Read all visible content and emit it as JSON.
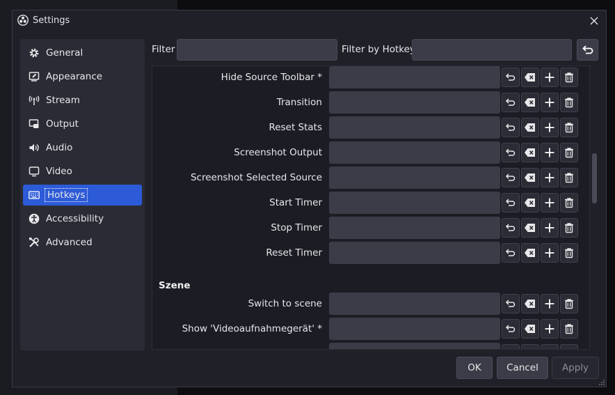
{
  "window": {
    "title": "Settings"
  },
  "sidebar": {
    "items": [
      {
        "label": "General",
        "icon": "gear-icon"
      },
      {
        "label": "Appearance",
        "icon": "appearance-icon"
      },
      {
        "label": "Stream",
        "icon": "broadcast-icon"
      },
      {
        "label": "Output",
        "icon": "output-icon"
      },
      {
        "label": "Audio",
        "icon": "speaker-icon"
      },
      {
        "label": "Video",
        "icon": "monitor-icon"
      },
      {
        "label": "Hotkeys",
        "icon": "keyboard-icon",
        "selected": true
      },
      {
        "label": "Accessibility",
        "icon": "accessibility-icon"
      },
      {
        "label": "Advanced",
        "icon": "tools-icon"
      }
    ]
  },
  "filters": {
    "filter_label": "Filter",
    "filter_value": "",
    "hotkey_label": "Filter by Hotkey",
    "hotkey_value": ""
  },
  "hotkeys": {
    "rows": [
      {
        "label": "Hide Source Toolbar *"
      },
      {
        "label": "Transition"
      },
      {
        "label": "Reset Stats"
      },
      {
        "label": "Screenshot Output"
      },
      {
        "label": "Screenshot Selected Source"
      },
      {
        "label": "Start Timer"
      },
      {
        "label": "Stop Timer"
      },
      {
        "label": "Reset Timer"
      }
    ],
    "section": "Szene",
    "section_rows": [
      {
        "label": "Switch to scene"
      },
      {
        "label": "Show 'Videoaufnahmegerät' *"
      },
      {
        "label": ""
      }
    ]
  },
  "footer": {
    "ok": "OK",
    "cancel": "Cancel",
    "apply": "Apply"
  },
  "colors": {
    "accent": "#2d5bd8",
    "window_bg": "#1f2028",
    "input_bg": "#3b3c48"
  }
}
